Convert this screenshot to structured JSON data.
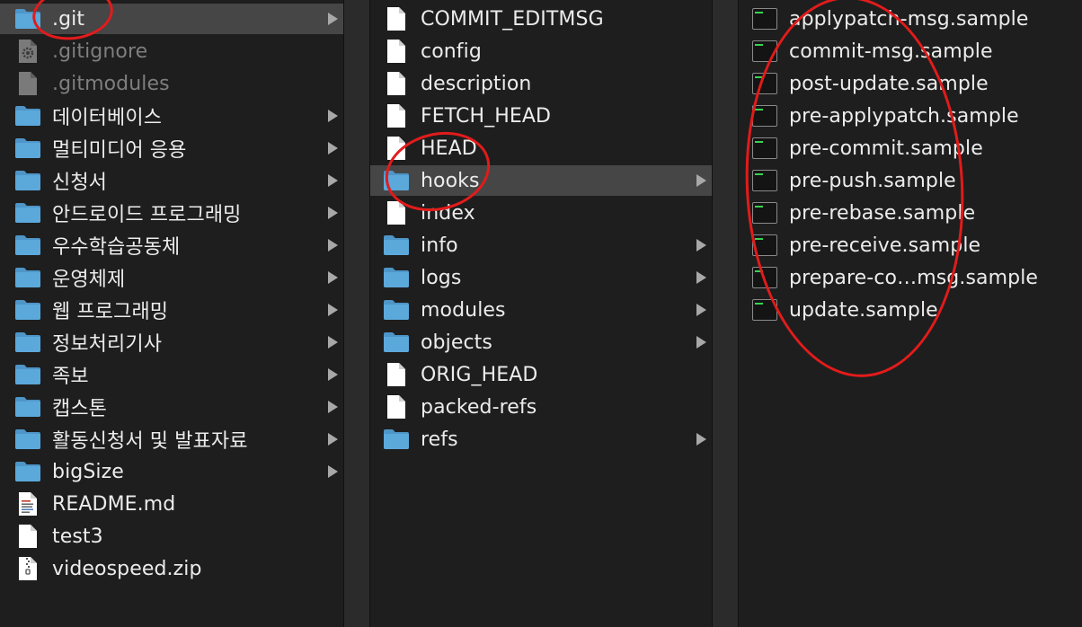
{
  "columns": [
    {
      "items": [
        {
          "label": ".git",
          "icon": "folder-icon",
          "kind": "folder",
          "chevron": true,
          "state": "selected",
          "dim": false
        },
        {
          "label": ".gitignore",
          "icon": "gear-file-icon",
          "kind": "gear",
          "chevron": false,
          "state": "",
          "dim": true
        },
        {
          "label": ".gitmodules",
          "icon": "document-icon",
          "kind": "greydoc",
          "chevron": false,
          "state": "",
          "dim": true
        },
        {
          "label": "데이터베이스",
          "icon": "folder-icon",
          "kind": "folder",
          "chevron": true,
          "state": "",
          "dim": false
        },
        {
          "label": "멀티미디어 응용",
          "icon": "folder-icon",
          "kind": "folder",
          "chevron": true,
          "state": "",
          "dim": false
        },
        {
          "label": "신청서",
          "icon": "folder-icon",
          "kind": "folder",
          "chevron": true,
          "state": "",
          "dim": false
        },
        {
          "label": "안드로이드 프로그래밍",
          "icon": "folder-icon",
          "kind": "folder",
          "chevron": true,
          "state": "",
          "dim": false
        },
        {
          "label": "우수학습공동체",
          "icon": "folder-icon",
          "kind": "folder",
          "chevron": true,
          "state": "",
          "dim": false
        },
        {
          "label": "운영체제",
          "icon": "folder-icon",
          "kind": "folder",
          "chevron": true,
          "state": "",
          "dim": false
        },
        {
          "label": "웹 프로그래밍",
          "icon": "folder-icon",
          "kind": "folder",
          "chevron": true,
          "state": "",
          "dim": false
        },
        {
          "label": "정보처리기사",
          "icon": "folder-icon",
          "kind": "folder",
          "chevron": true,
          "state": "",
          "dim": false
        },
        {
          "label": "족보",
          "icon": "folder-icon",
          "kind": "folder",
          "chevron": true,
          "state": "",
          "dim": false
        },
        {
          "label": "캡스톤",
          "icon": "folder-icon",
          "kind": "folder",
          "chevron": true,
          "state": "",
          "dim": false
        },
        {
          "label": "활동신청서 및 발표자료",
          "icon": "folder-icon",
          "kind": "folder",
          "chevron": true,
          "state": "",
          "dim": false
        },
        {
          "label": "bigSize",
          "icon": "folder-icon",
          "kind": "folder",
          "chevron": true,
          "state": "",
          "dim": false
        },
        {
          "label": "README.md",
          "icon": "markdown-file-icon",
          "kind": "mddoc",
          "chevron": false,
          "state": "",
          "dim": false
        },
        {
          "label": "test3",
          "icon": "document-icon",
          "kind": "doc",
          "chevron": false,
          "state": "",
          "dim": false
        },
        {
          "label": "videospeed.zip",
          "icon": "zip-file-icon",
          "kind": "zip",
          "chevron": false,
          "state": "",
          "dim": false
        }
      ]
    },
    {
      "items": [
        {
          "label": "COMMIT_EDITMSG",
          "icon": "document-icon",
          "kind": "doc",
          "chevron": false,
          "state": ""
        },
        {
          "label": "config",
          "icon": "document-icon",
          "kind": "doc",
          "chevron": false,
          "state": ""
        },
        {
          "label": "description",
          "icon": "document-icon",
          "kind": "doc",
          "chevron": false,
          "state": ""
        },
        {
          "label": "FETCH_HEAD",
          "icon": "document-icon",
          "kind": "doc",
          "chevron": false,
          "state": ""
        },
        {
          "label": "HEAD",
          "icon": "document-icon",
          "kind": "doc",
          "chevron": false,
          "state": ""
        },
        {
          "label": "hooks",
          "icon": "folder-icon",
          "kind": "folder",
          "chevron": true,
          "state": "selected"
        },
        {
          "label": "index",
          "icon": "document-icon",
          "kind": "doc",
          "chevron": false,
          "state": ""
        },
        {
          "label": "info",
          "icon": "folder-icon",
          "kind": "folder",
          "chevron": true,
          "state": ""
        },
        {
          "label": "logs",
          "icon": "folder-icon",
          "kind": "folder",
          "chevron": true,
          "state": ""
        },
        {
          "label": "modules",
          "icon": "folder-icon",
          "kind": "folder",
          "chevron": true,
          "state": ""
        },
        {
          "label": "objects",
          "icon": "folder-icon",
          "kind": "folder",
          "chevron": true,
          "state": ""
        },
        {
          "label": "ORIG_HEAD",
          "icon": "document-icon",
          "kind": "doc",
          "chevron": false,
          "state": ""
        },
        {
          "label": "packed-refs",
          "icon": "document-icon",
          "kind": "doc",
          "chevron": false,
          "state": ""
        },
        {
          "label": "refs",
          "icon": "folder-icon",
          "kind": "folder",
          "chevron": true,
          "state": ""
        }
      ]
    },
    {
      "items": [
        {
          "label": "applypatch-msg.sample",
          "icon": "terminal-file-icon",
          "kind": "exec",
          "chevron": false,
          "state": ""
        },
        {
          "label": "commit-msg.sample",
          "icon": "terminal-file-icon",
          "kind": "exec",
          "chevron": false,
          "state": ""
        },
        {
          "label": "post-update.sample",
          "icon": "terminal-file-icon",
          "kind": "exec",
          "chevron": false,
          "state": ""
        },
        {
          "label": "pre-applypatch.sample",
          "icon": "terminal-file-icon",
          "kind": "exec",
          "chevron": false,
          "state": ""
        },
        {
          "label": "pre-commit.sample",
          "icon": "terminal-file-icon",
          "kind": "exec",
          "chevron": false,
          "state": ""
        },
        {
          "label": "pre-push.sample",
          "icon": "terminal-file-icon",
          "kind": "exec",
          "chevron": false,
          "state": ""
        },
        {
          "label": "pre-rebase.sample",
          "icon": "terminal-file-icon",
          "kind": "exec",
          "chevron": false,
          "state": ""
        },
        {
          "label": "pre-receive.sample",
          "icon": "terminal-file-icon",
          "kind": "exec",
          "chevron": false,
          "state": ""
        },
        {
          "label": "prepare-co…msg.sample",
          "icon": "terminal-file-icon",
          "kind": "exec",
          "chevron": false,
          "state": ""
        },
        {
          "label": "update.sample",
          "icon": "terminal-file-icon",
          "kind": "exec",
          "chevron": false,
          "state": ""
        }
      ]
    }
  ],
  "colors": {
    "background": "#1e1e1e",
    "selection": "#464646",
    "folder": "#5ba8db",
    "annotation": "#e21b1b"
  }
}
